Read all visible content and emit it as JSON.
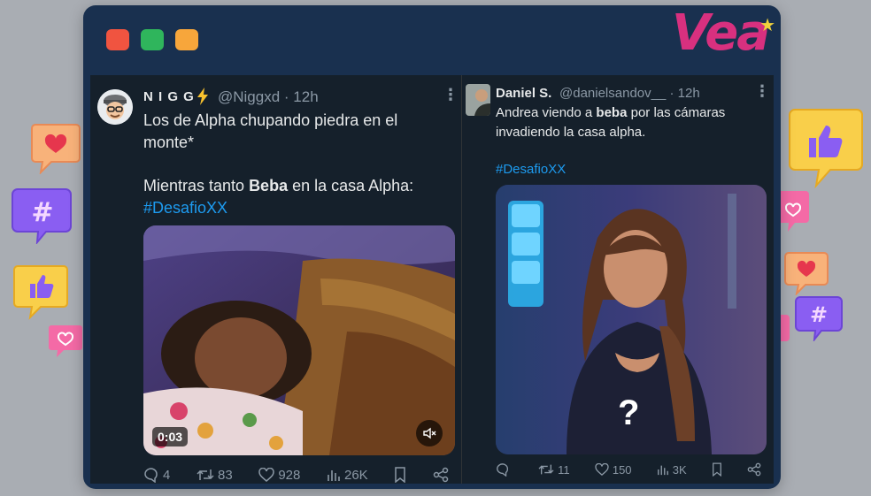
{
  "colors": {
    "background": "#a9adb3",
    "frame": "#19304f",
    "dot_red": "#f05440",
    "dot_green": "#2fb55c",
    "dot_yellow": "#f7a63b",
    "logo": "#d8307f",
    "tweet_bg": "#15202b",
    "hashtag": "#1d9bf0"
  },
  "logo": {
    "text": "Vea",
    "star": "★"
  },
  "tweets": [
    {
      "name": "N I G G",
      "name_icon": "lightning-icon",
      "handle": "@Niggxd · 12h",
      "lines": [
        "Los de Alpha chupando piedra en el",
        "monte*"
      ],
      "line3_pre": "Mientras tanto ",
      "line3_bold": "Beba",
      "line3_post": " en la casa Alpha:",
      "hashtag": "#DesafioXX",
      "video_time": "0:03",
      "stats": {
        "replies": "4",
        "retweets": "83",
        "likes": "928",
        "views": "26K"
      }
    },
    {
      "name": "Daniel S.",
      "handle": "@danielsandov__ · 12h",
      "line1_pre": "Andrea viendo a ",
      "line1_bold": "beba",
      "line1_post": " por las cámaras",
      "line2": "invadiendo la casa alpha.",
      "hashtag": "#DesafioXX",
      "overlay": "?",
      "stats": {
        "replies": "",
        "retweets": "11",
        "likes": "150",
        "views": "3K"
      }
    }
  ]
}
